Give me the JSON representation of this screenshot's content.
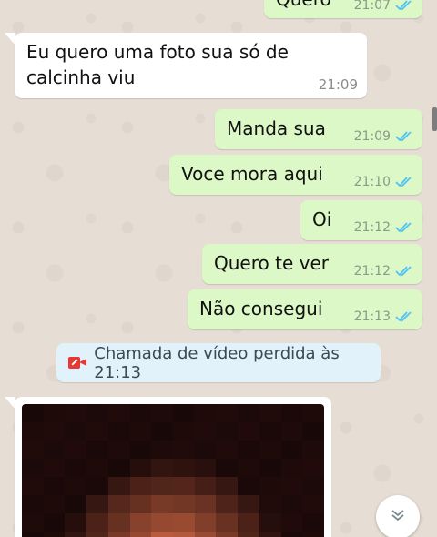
{
  "messages": [
    {
      "id": "m0",
      "direction": "out",
      "text": "Quero",
      "time": "21:07"
    },
    {
      "id": "m1",
      "direction": "in",
      "text_line1": "Eu quero uma foto sua só de",
      "text_line2": "calcinha viu",
      "time": "21:09"
    },
    {
      "id": "m2",
      "direction": "out",
      "text": "Manda sua",
      "time": "21:09"
    },
    {
      "id": "m3",
      "direction": "out",
      "text": "Voce mora aqui",
      "time": "21:10"
    },
    {
      "id": "m4",
      "direction": "out",
      "text": "Oi",
      "time": "21:12"
    },
    {
      "id": "m5",
      "direction": "out",
      "text": "Quero te ver",
      "time": "21:12"
    },
    {
      "id": "m6",
      "direction": "out",
      "text": "Não consegui",
      "time": "21:13"
    }
  ],
  "system": {
    "missed_call": "Chamada de vídeo perdida às 21:13"
  },
  "colors": {
    "outgoing": "#dcf8c6",
    "incoming": "#ffffff",
    "read_ticks": "#4fc3f7",
    "missed_call_icon": "#e53935"
  },
  "icons": {
    "read_receipt": "double-check-icon",
    "missed_video_call": "missed-video-call-icon",
    "scroll_down": "chevron-down-icon"
  }
}
